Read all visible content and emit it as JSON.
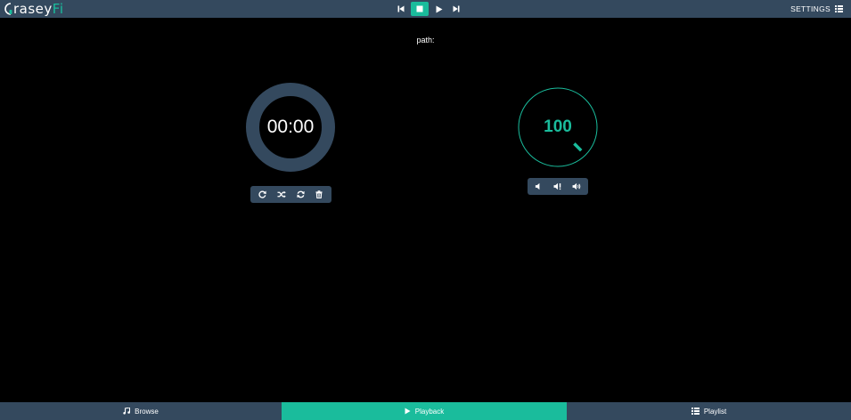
{
  "app": {
    "logo_prefix": "rasey",
    "logo_accent": "Fi"
  },
  "transport": {
    "icons": [
      "skip-back-icon",
      "stop-icon",
      "play-icon",
      "skip-forward-icon"
    ],
    "active": "stop"
  },
  "header": {
    "settings_label": "SETTINGS",
    "settings_icon": "grid-menu-icon"
  },
  "playback": {
    "path_label": "path:",
    "elapsed": "00:00",
    "queue_tools": [
      "repeat-icon",
      "shuffle-icon",
      "refresh-icon",
      "trash-icon"
    ]
  },
  "volume": {
    "value": "100",
    "level": 100,
    "tools": [
      "volume-down-icon",
      "mute-icon",
      "volume-up-icon"
    ]
  },
  "nav": {
    "tabs": [
      {
        "label": "Browse",
        "icon": "music-note-icon"
      },
      {
        "label": "Playback",
        "icon": "play-icon"
      },
      {
        "label": "Playlist",
        "icon": "list-icon"
      }
    ],
    "active_tab": "Playback"
  },
  "colors": {
    "accent": "#1abc9c",
    "bar": "#34495e",
    "background": "#000000"
  }
}
